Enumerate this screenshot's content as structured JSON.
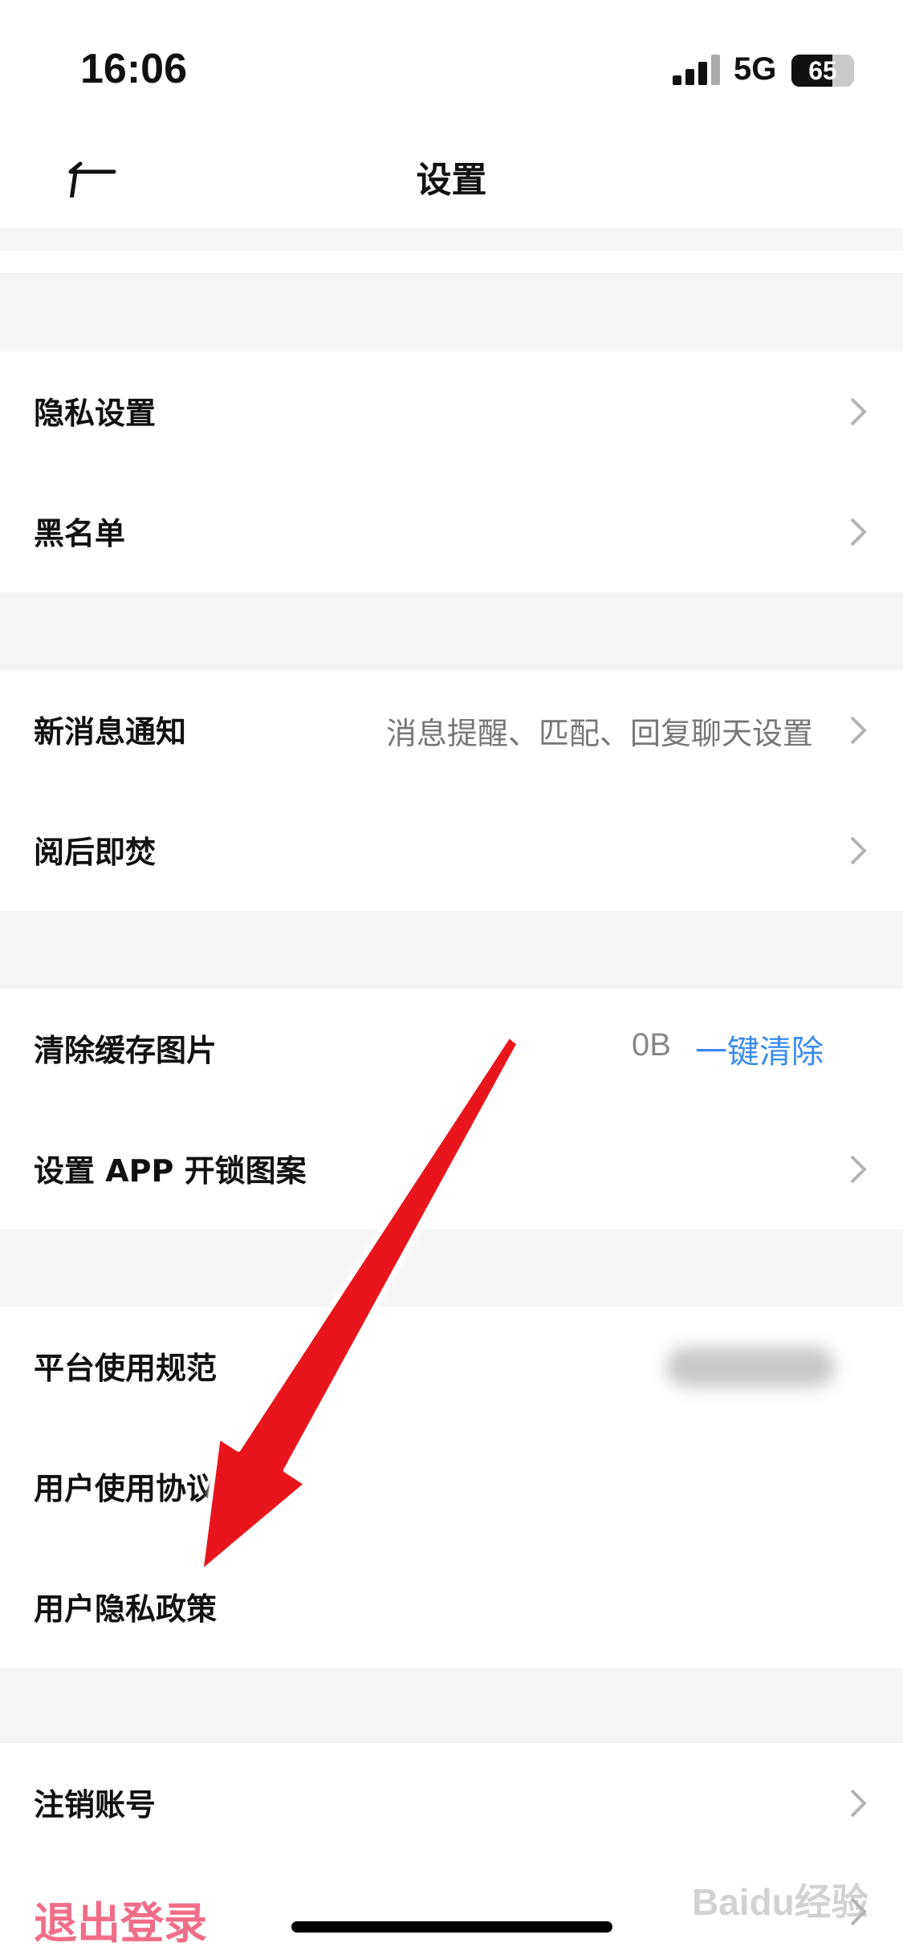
{
  "status": {
    "time": "16:06",
    "network": "5G",
    "battery": "65",
    "battery_level": 0.65
  },
  "header": {
    "title": "设置"
  },
  "groups": [
    {
      "rows": [
        {
          "label": "隐私设置"
        },
        {
          "label": "黑名单"
        }
      ]
    },
    {
      "rows": [
        {
          "label": "新消息通知",
          "value": "消息提醒、匹配、回复聊天设置"
        },
        {
          "label": "阅后即焚"
        }
      ]
    },
    {
      "rows": [
        {
          "label": "清除缓存图片",
          "size": "0B",
          "action": "一键清除"
        },
        {
          "label": "设置 APP 开锁图案"
        }
      ]
    },
    {
      "rows": [
        {
          "label": "平台使用规范"
        },
        {
          "label": "用户使用协议"
        },
        {
          "label": "用户隐私政策"
        }
      ]
    },
    {
      "rows": [
        {
          "label": "注销账号"
        },
        {
          "label": "退出登录"
        }
      ]
    }
  ],
  "watermark": "Baidu经验",
  "colors": {
    "accent": "#3a8cf0",
    "logout": "#f06d8a",
    "annotation_arrow": "#e8141b"
  }
}
